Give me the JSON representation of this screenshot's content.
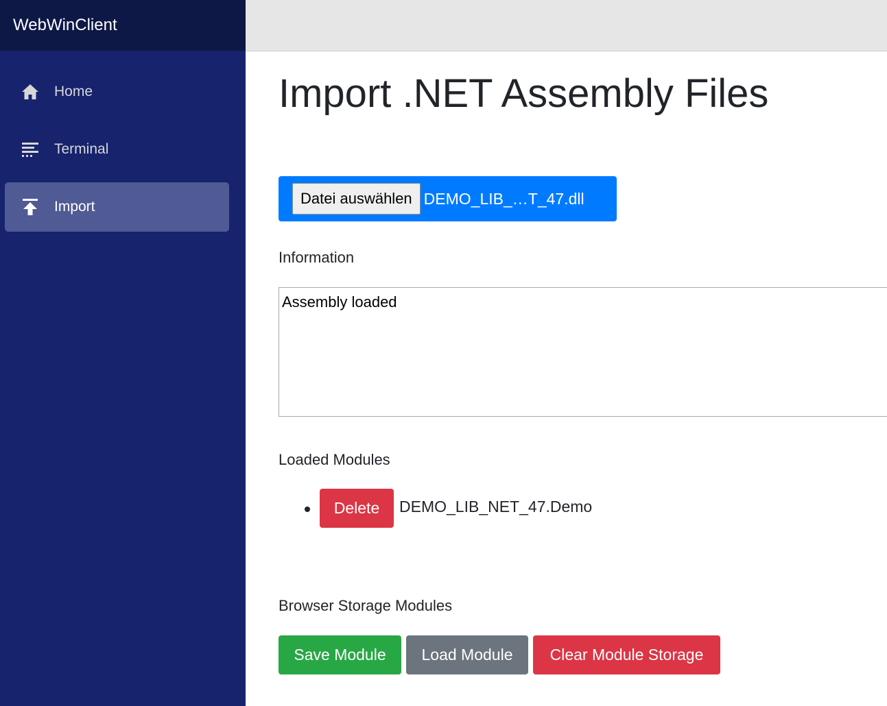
{
  "app": {
    "title": "WebWinClient"
  },
  "sidebar": {
    "items": [
      {
        "label": "Home",
        "icon": "home-icon",
        "active": false
      },
      {
        "label": "Terminal",
        "icon": "terminal-icon",
        "active": false
      },
      {
        "label": "Import",
        "icon": "upload-icon",
        "active": true
      }
    ]
  },
  "main": {
    "title": "Import .NET Assembly Files",
    "file_picker": {
      "button_label": "Datei auswählen",
      "selected_file": "DEMO_LIB_…T_47.dll"
    },
    "information": {
      "label": "Information",
      "value": "Assembly loaded"
    },
    "loaded_modules": {
      "label": "Loaded Modules",
      "items": [
        {
          "delete_label": "Delete",
          "name": "DEMO_LIB_NET_47.Demo"
        }
      ]
    },
    "browser_storage": {
      "label": "Browser Storage Modules",
      "save_label": "Save Module",
      "load_label": "Load Module",
      "clear_label": "Clear Module Storage"
    }
  },
  "colors": {
    "sidebar_bg": "#17236d",
    "brand_bg": "#0e1847",
    "active_item_bg": "#505a94",
    "primary": "#007bff",
    "success": "#28a745",
    "secondary": "#6c757d",
    "danger": "#dc3545"
  }
}
